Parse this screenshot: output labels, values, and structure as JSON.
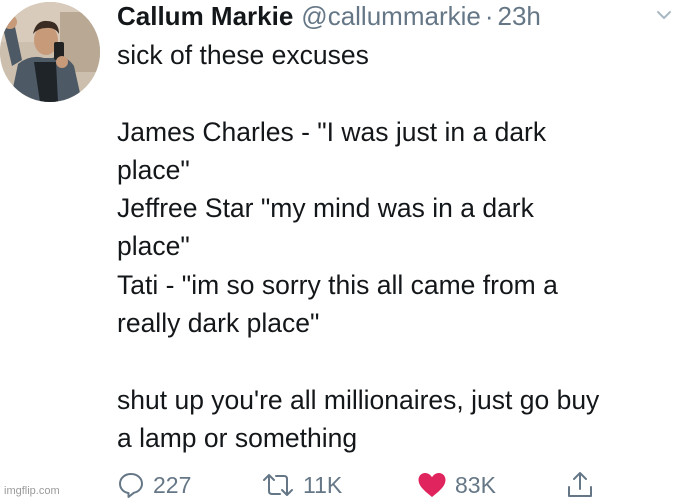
{
  "tweet": {
    "display_name": "Callum Markie",
    "handle": "@callummarkie",
    "separator": "·",
    "timestamp": "23h",
    "lines": [
      "sick of these excuses",
      "",
      "James Charles - \"I was just in a dark",
      "place\"",
      "Jeffree Star \"my mind was in a dark",
      "place\"",
      "Tati - \"im so sorry this all came from a",
      "really dark place\"",
      "",
      "shut up you're all millionaires, just go buy",
      "a lamp or something"
    ],
    "actions": {
      "reply_count": "227",
      "retweet_count": "11K",
      "like_count": "83K"
    },
    "like_color": "#e0245e",
    "icon_color": "#657786"
  },
  "watermark": "imgflip.com"
}
